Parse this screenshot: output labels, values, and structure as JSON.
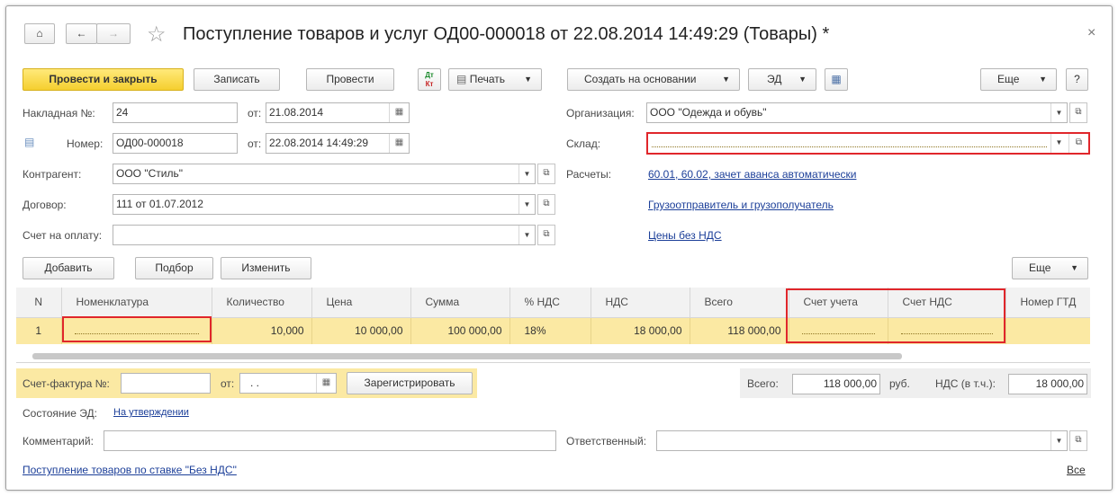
{
  "title": "Поступление товаров и услуг ОД00-000018 от 22.08.2014 14:49:29 (Товары) *",
  "toolbar": {
    "post_close": "Провести и закрыть",
    "save": "Записать",
    "post": "Провести",
    "print": "Печать",
    "create_based": "Создать на основании",
    "ed": "ЭД",
    "more": "Еще",
    "help": "?"
  },
  "header": {
    "invoice_label": "Накладная №:",
    "invoice_value": "24",
    "from_label": "от:",
    "invoice_date": "21.08.2014",
    "number_label": "Номер:",
    "number_value": "ОД00-000018",
    "number_date": "22.08.2014 14:49:29",
    "counterparty_label": "Контрагент:",
    "counterparty_value": "ООО \"Стиль\"",
    "contract_label": "Договор:",
    "contract_value": "111 от 01.07.2012",
    "payment_invoice_label": "Счет на оплату:",
    "payment_invoice_value": "",
    "org_label": "Организация:",
    "org_value": "ООО \"Одежда и обувь\"",
    "warehouse_label": "Склад:",
    "warehouse_value": "",
    "settlements_label": "Расчеты:",
    "settlements_link": "60.01, 60.02, зачет аванса автоматически",
    "shipper_link": "Грузоотправитель и грузополучатель",
    "prices_link": "Цены без НДС"
  },
  "table_toolbar": {
    "add": "Добавить",
    "pick": "Подбор",
    "edit": "Изменить",
    "more": "Еще"
  },
  "table": {
    "columns": [
      "N",
      "Номенклатура",
      "Количество",
      "Цена",
      "Сумма",
      "% НДС",
      "НДС",
      "Всего",
      "Счет учета",
      "Счет НДС",
      "Номер ГТД"
    ],
    "rows": [
      [
        "1",
        "",
        "10,000",
        "10 000,00",
        "100 000,00",
        "18%",
        "18 000,00",
        "118 000,00",
        "",
        "",
        ""
      ]
    ]
  },
  "footer": {
    "sf_label": "Счет-фактура №:",
    "sf_value": "",
    "sf_from": "от:",
    "sf_date": " .  .",
    "register": "Зарегистрировать",
    "total_label": "Всего:",
    "total_value": "118 000,00",
    "currency": "руб.",
    "vat_label": "НДС (в т.ч.):",
    "vat_value": "18 000,00",
    "ed_state_label": "Состояние ЭД:",
    "ed_state_link": "На утверждении",
    "comment_label": "Комментарий:",
    "comment_value": "",
    "responsible_label": "Ответственный:",
    "responsible_value": "",
    "bottom_link": "Поступление товаров по ставке \"Без НДС\"",
    "all_link": "Все"
  }
}
